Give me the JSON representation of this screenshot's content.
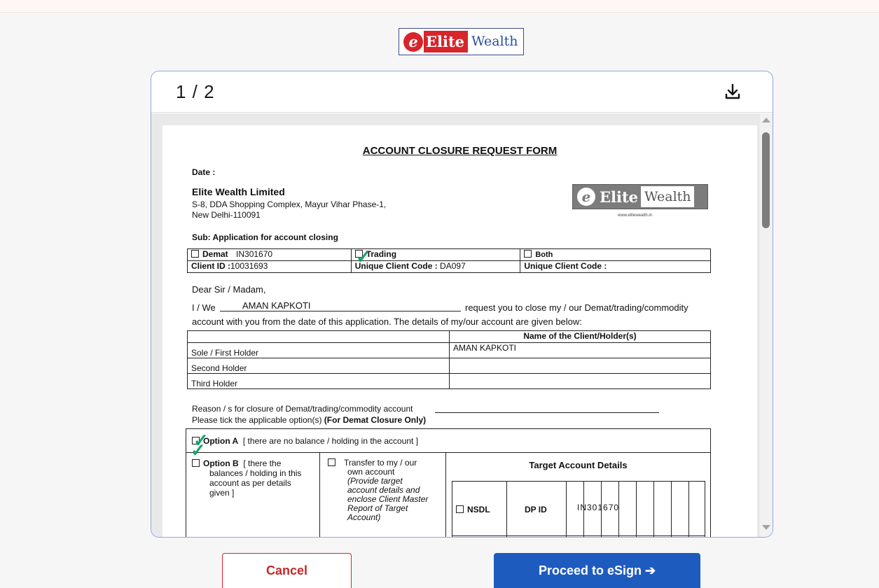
{
  "brand": {
    "logo_e": "e",
    "logo_elite": "Elite",
    "logo_wealth": "Wealth"
  },
  "viewer": {
    "page_indicator": "1 / 2",
    "download_icon": "download-icon"
  },
  "form": {
    "title": "ACCOUNT CLOSURE REQUEST FORM",
    "date_label": "Date :",
    "company_name": "Elite Wealth Limited",
    "address_line1": "S-8, DDA Shopping Complex, Mayur Vihar Phase-1,",
    "address_line2": "New Delhi-110091",
    "logo_elite": "Elite",
    "logo_wealth": "Wealth",
    "website": "www.elitewealth.in",
    "subject": "Sub: Application for account closing",
    "account_type": {
      "demat_label": "Demat",
      "demat_value": "IN301670",
      "trading_label": "Trading",
      "both_label": "Both",
      "client_id_label": "Client ID :",
      "client_id_value": "10031693",
      "ucc_label": "Unique Client Code :",
      "ucc_value": "DA097",
      "ucc_label_2": "Unique Client Code :"
    },
    "salutation": "Dear Sir / Madam,",
    "iwe_label": "I / We",
    "iwe_name": "AMAN KAPKOTI",
    "request_text": "request you to close my / our Demat/trading/commodity",
    "request_text_2": "account with you from the date of this application. The details of my/our account are given below:",
    "holders_header": "Name of the Client/Holder(s)",
    "holders": [
      {
        "label": "Sole / First Holder",
        "name": "AMAN KAPKOTI"
      },
      {
        "label": "Second Holder",
        "name": ""
      },
      {
        "label": "Third Holder",
        "name": ""
      }
    ],
    "reason_text": "Reason / s for closure of Demat/trading/commodity account",
    "tick_text": "Please tick the applicable option(s)",
    "tick_text_bold": "(For Demat Closure Only)",
    "option_a_label": "Option A",
    "option_a_text": "[ there are no balance / holding in the account ]",
    "option_b_label": "Option B",
    "option_b_text_1": "[ there the",
    "option_b_text_2": "balances / holding in this",
    "option_b_text_3": "account as per details",
    "option_b_text_4": "given ]",
    "transfer_1": "Transfer to my / our",
    "transfer_2": "own account",
    "transfer_3": "(Provide target",
    "transfer_4": "account details and",
    "transfer_5": "enclose Client Master",
    "transfer_6": "Report of Target",
    "transfer_7": "Account)",
    "target_header": "Target Account Details",
    "nsdl_label": "NSDL",
    "dpid_label": "DP ID",
    "dpid_value": "IN301670"
  },
  "actions": {
    "cancel": "Cancel",
    "proceed": "Proceed to eSign ➔"
  },
  "colors": {
    "brand_red": "#d7252b",
    "brand_blue": "#2b4da1",
    "primary_button": "#1e5bbf",
    "tick_green": "#19a36b"
  }
}
